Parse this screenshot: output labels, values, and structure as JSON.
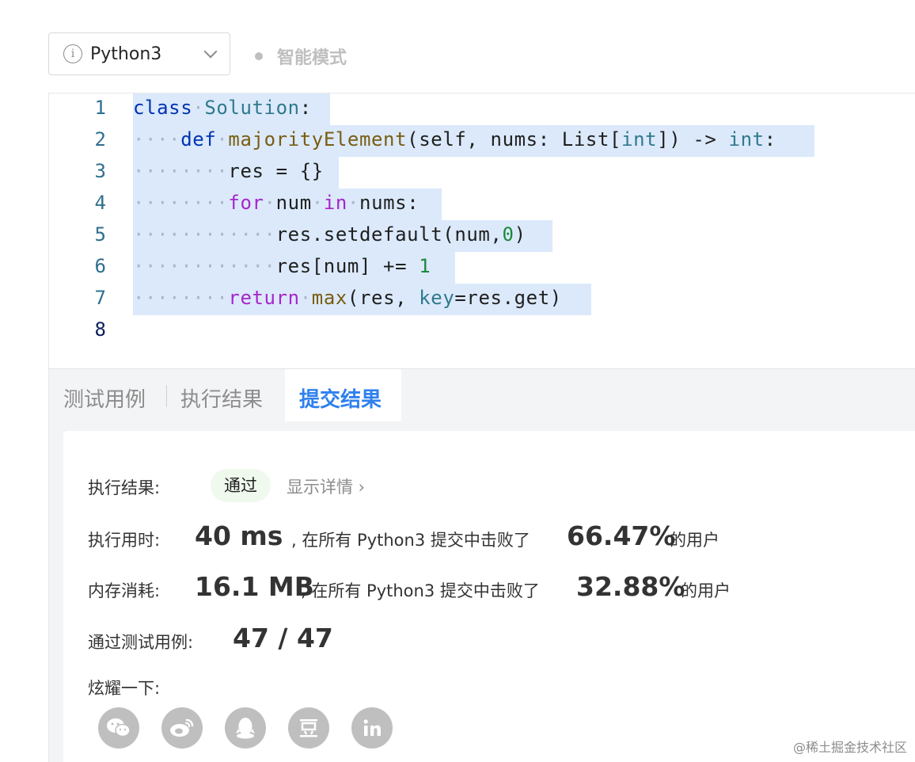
{
  "toolbar": {
    "language": "Python3",
    "mode": "智能模式"
  },
  "editor": {
    "lines": [
      {
        "n": "1"
      },
      {
        "n": "2"
      },
      {
        "n": "3"
      },
      {
        "n": "4"
      },
      {
        "n": "5"
      },
      {
        "n": "6"
      },
      {
        "n": "7"
      },
      {
        "n": "8"
      }
    ],
    "code": {
      "l1_kw": "class",
      "l1_name": "Solution",
      "l1_colon": ":",
      "l2_kw": "def",
      "l2_fn": "majorityElement",
      "l2_a": "(self, nums: List[",
      "l2_t1": "int",
      "l2_b": "]) -> ",
      "l2_t2": "int",
      "l2_c": ":",
      "l3": "res = {}",
      "l4_for": "for",
      "l4_a": "num",
      "l4_in": "in",
      "l4_b": "nums:",
      "l5_a": "res.setdefault(num,",
      "l5_n": "0",
      "l5_b": ")",
      "l6_a": "res[num] += ",
      "l6_n": "1",
      "l7_kw": "return",
      "l7_fn": "max",
      "l7_a": "(res, ",
      "l7_key": "key",
      "l7_b": "=res.get)"
    }
  },
  "tabs": [
    {
      "label": "测试用例",
      "active": false
    },
    {
      "label": "执行结果",
      "active": false
    },
    {
      "label": "提交结果",
      "active": true
    }
  ],
  "result": {
    "status_label": "执行结果:",
    "status_value": "通过",
    "detail_link": "显示详情 ›",
    "runtime_label": "执行用时:",
    "runtime_value": "40 ms",
    "runtime_text": ", 在所有 Python3 提交中击败了",
    "runtime_percent": "66.47%",
    "runtime_suffix": "的用户",
    "memory_label": "内存消耗:",
    "memory_value": "16.1 MB",
    "memory_text": ", 在所有 Python3 提交中击败了",
    "memory_percent": "32.88%",
    "memory_suffix": "的用户",
    "cases_label": "通过测试用例:",
    "cases_value": "47 / 47",
    "share_label": "炫耀一下:"
  },
  "share_icons": [
    "wechat-icon",
    "weibo-icon",
    "qq-icon",
    "douban-icon",
    "linkedin-icon"
  ],
  "watermark": "@稀土掘金技术社区",
  "colors": {
    "accent": "#2f80ed",
    "selection": "#dbe9fb",
    "pass_bg": "#f0f9ee"
  }
}
